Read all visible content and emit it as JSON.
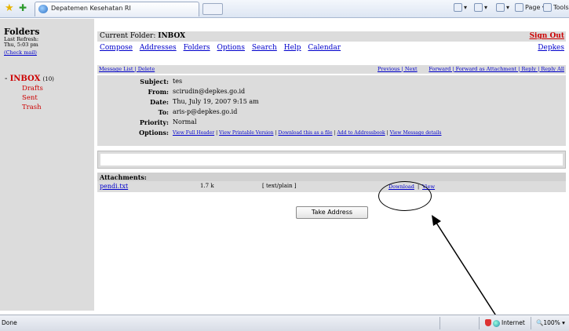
{
  "browser": {
    "tab_title": "Depatemen Kesehatan RI",
    "cmd_home": "",
    "cmd_feeds": "",
    "cmd_print": "",
    "cmd_page": "Page",
    "cmd_tools": "Tools",
    "status_text": "Done",
    "zone_label": "Internet",
    "zoom_label": "100%"
  },
  "sidebar": {
    "title": "Folders",
    "last_refresh_label": "Last Refresh:",
    "last_refresh_value": "Thu, 5:03 pm",
    "check_mail": "(Check mail)",
    "inbox_label": "INBOX",
    "inbox_count": "(10)",
    "folders": [
      "Drafts",
      "Sent",
      "Trash"
    ]
  },
  "header": {
    "current_folder_label": "Current Folder:",
    "current_folder": "INBOX",
    "sign_out": "Sign Out",
    "nav": [
      "Compose",
      "Addresses",
      "Folders",
      "Options",
      "Search",
      "Help",
      "Calendar"
    ],
    "org_link": "Depkes"
  },
  "msgbar": {
    "left": "Message List | Delete",
    "middle": "Previous | Next",
    "right": "Forward | Forward as Attachment | Reply | Reply All"
  },
  "message": {
    "subject_label": "Subject:",
    "subject": "tes",
    "from_label": "From:",
    "from": "scirudin@depkes.go.id",
    "date_label": "Date:",
    "date": "Thu, July 19, 2007 9:15 am",
    "to_label": "To:",
    "to": "aris-p@depkes.go.id",
    "priority_label": "Priority:",
    "priority": "Normal",
    "options_label": "Options:",
    "options": [
      "View Full Header",
      "View Printable Version",
      "Download this as a file",
      "Add to Addressbook",
      "View Message details"
    ]
  },
  "attachments": {
    "title": "Attachments:",
    "file_name": "pendi.txt",
    "file_size": "1.7 k",
    "file_type": "[ text/plain ]",
    "download": "Download",
    "separator": "|",
    "view": "View"
  },
  "take_address": "Take Address"
}
